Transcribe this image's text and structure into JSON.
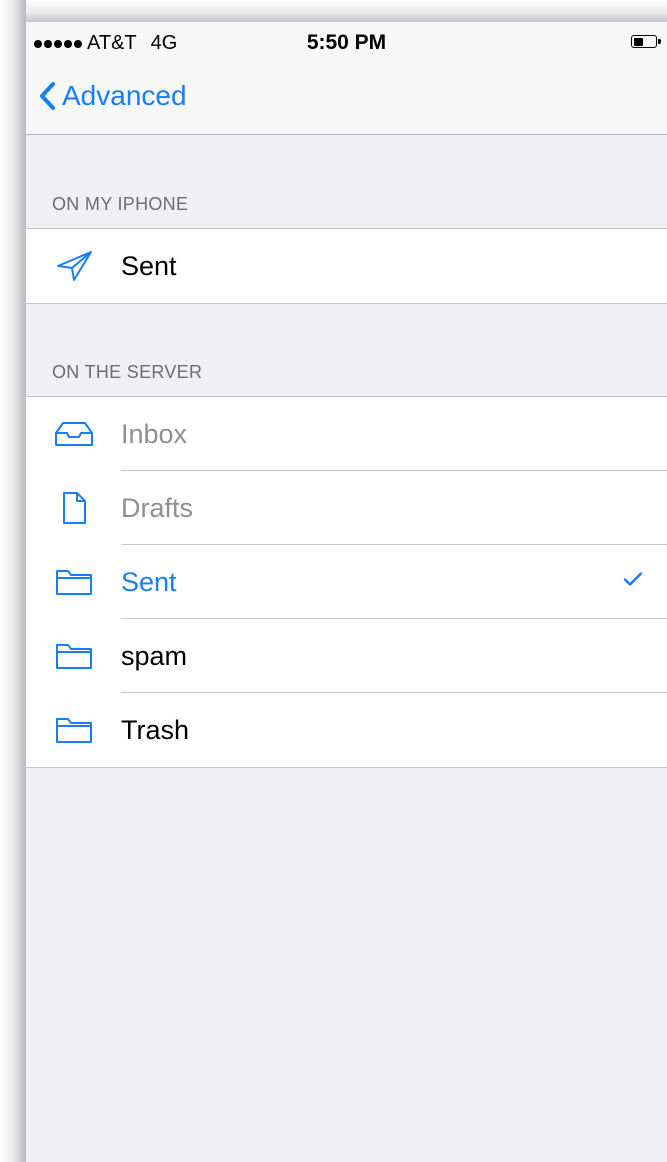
{
  "status": {
    "carrier": "AT&T",
    "network": "4G",
    "time": "5:50 PM",
    "battery_level": 0.45
  },
  "nav": {
    "back_label": "Advanced"
  },
  "sections": {
    "on_my_iphone": {
      "header": "ON MY IPHONE",
      "items": [
        {
          "label": "Sent",
          "icon": "paper-plane-icon"
        }
      ]
    },
    "on_the_server": {
      "header": "ON THE SERVER",
      "items": [
        {
          "label": "Inbox",
          "icon": "inbox-tray-icon",
          "state": "disabled"
        },
        {
          "label": "Drafts",
          "icon": "document-icon",
          "state": "disabled"
        },
        {
          "label": "Sent",
          "icon": "folder-icon",
          "state": "selected"
        },
        {
          "label": "spam",
          "icon": "folder-icon",
          "state": "normal"
        },
        {
          "label": "Trash",
          "icon": "folder-icon",
          "state": "normal"
        }
      ]
    }
  },
  "colors": {
    "accent": "#157efb",
    "background": "#efeff4",
    "disabled_text": "#8e8e93",
    "section_header": "#6d6d72"
  }
}
